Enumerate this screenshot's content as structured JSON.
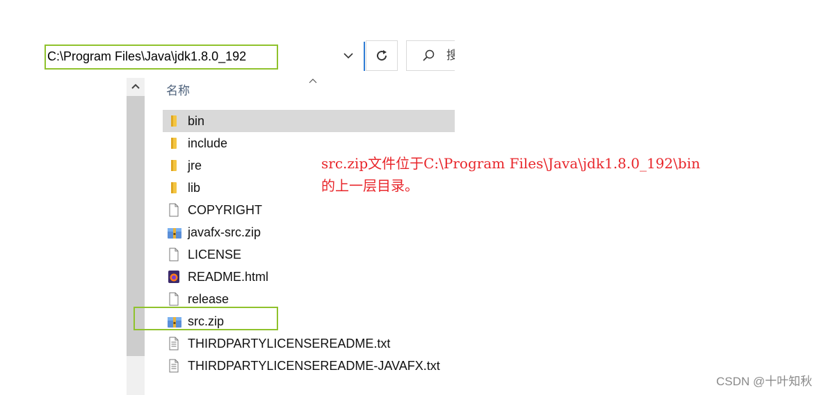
{
  "address_bar": {
    "path": "C:\\Program Files\\Java\\jdk1.8.0_192"
  },
  "search": {
    "placeholder": "搜"
  },
  "columns": {
    "name": "名称"
  },
  "files": [
    {
      "name": "bin",
      "icon": "folder-icon",
      "selected": true
    },
    {
      "name": "include",
      "icon": "folder-icon",
      "selected": false
    },
    {
      "name": "jre",
      "icon": "folder-icon",
      "selected": false
    },
    {
      "name": "lib",
      "icon": "folder-icon",
      "selected": false
    },
    {
      "name": "COPYRIGHT",
      "icon": "file-icon",
      "selected": false
    },
    {
      "name": "javafx-src.zip",
      "icon": "zip-archive-icon",
      "selected": false
    },
    {
      "name": "LICENSE",
      "icon": "file-icon",
      "selected": false
    },
    {
      "name": "README.html",
      "icon": "firefox-html-icon",
      "selected": false
    },
    {
      "name": "release",
      "icon": "file-icon",
      "selected": false
    },
    {
      "name": "src.zip",
      "icon": "zip-archive-icon",
      "selected": false
    },
    {
      "name": "THIRDPARTYLICENSEREADME.txt",
      "icon": "text-file-icon",
      "selected": false
    },
    {
      "name": "THIRDPARTYLICENSEREADME-JAVAFX.txt",
      "icon": "text-file-icon",
      "selected": false
    }
  ],
  "annotation": {
    "line1": "src.zip文件位于C:\\Program Files\\Java\\jdk1.8.0_192\\bin",
    "line2": "的上一层目录。"
  },
  "watermark": "CSDN @十叶知秋",
  "colors": {
    "highlight": "#8fc22c",
    "annotation": "#e8252a",
    "selection": "#d9d9d9",
    "folder": "#f4c542"
  }
}
